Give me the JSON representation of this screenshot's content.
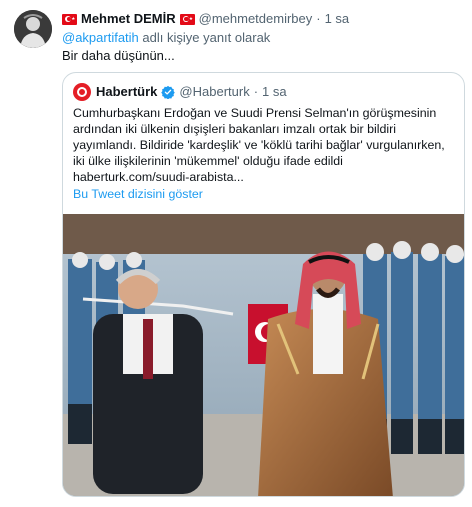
{
  "tweet": {
    "display_name": "Mehmet DEMİR",
    "handle": "@mehmetdemirbey",
    "separator": "·",
    "time": "1 sa",
    "reply_prefix": "",
    "reply_mention": "@akpartifatih",
    "reply_suffix": " adlı kişiye yanıt olarak",
    "text": "Bir daha düşünün..."
  },
  "quote": {
    "display_name": "Habertürk",
    "handle": "@Haberturk",
    "separator": "·",
    "time": "1 sa",
    "text": "Cumhurbaşkanı Erdoğan ve Suudi Prensi Selman'ın görüşmesinin ardından iki ülkenin dışişleri bakanları imzalı ortak bir bildiri yayımlandı. Bildiride 'kardeşlik' ve 'köklü tarihi bağlar' vurgulanırken, iki ülke ilişkilerinin 'mükemmel' olduğu ifade edildi haberturk.com/suudi-arabista...",
    "show_thread": "Bu Tweet dizisini göster"
  },
  "icons": {
    "flag": "turkey-flag-icon",
    "verified": "verified-badge-icon",
    "logo": "haberturk-logo-icon"
  },
  "colors": {
    "link": "#1d9bf0",
    "secondary_text": "#536471",
    "border": "#cfd9de",
    "flag_red": "#e30a17",
    "haberturk_red": "#e41e26"
  }
}
